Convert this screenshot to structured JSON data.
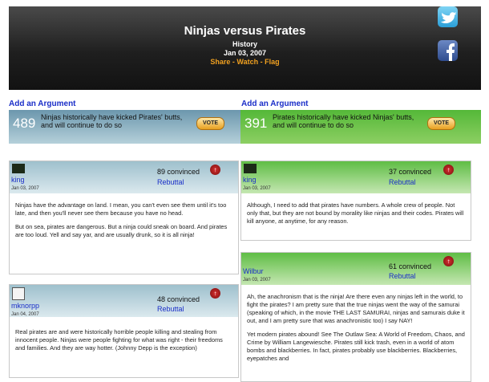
{
  "header": {
    "title": "Ninjas versus Pirates",
    "category": "History",
    "date": "Jan 03, 2007",
    "links": [
      "Share",
      "Watch",
      "Flag"
    ],
    "separator": " - "
  },
  "icons": {
    "twitter": "twitter-icon",
    "facebook": "facebook-icon",
    "rebuttal_up": "up-arrow-icon",
    "avatar": "user-avatar"
  },
  "colors": {
    "accent_link": "#1a2ec8",
    "header_link": "#f0a020",
    "blue_side": "#6c97ad",
    "green_side": "#54b838"
  },
  "left": {
    "add_label": "Add an Argument",
    "argument": {
      "count": "489",
      "text": "Ninjas historically have kicked Pirates' butts, and will continue to do so",
      "vote": "VOTE"
    },
    "rebuttals": [
      {
        "user": "king",
        "date": "Jan 03, 2007",
        "convinced": "89 convinced",
        "rebuttal": "Rebuttal",
        "paragraphs": [
          "Ninjas have the advantage on land. I mean, you can't even see them until it's too late, and then you'll never see them because you have no head.",
          "But on sea, pirates are dangerous. But a ninja could sneak on board. And pirates are too loud. Yell and say yar, and are usually drunk, so it is all ninja!"
        ]
      },
      {
        "user": "mknorpp",
        "date": "Jan 04, 2007",
        "convinced": "48 convinced",
        "rebuttal": "Rebuttal",
        "paragraphs": [
          "Real pirates are and were historically horrible people killing and stealing from innocent people. Ninjas were people fighting for what was right - their freedoms and families. And they are way hotter. (Johnny Depp is the exception)"
        ]
      }
    ]
  },
  "right": {
    "add_label": "Add an Argument",
    "argument": {
      "count": "391",
      "text": "Pirates historically have kicked Ninjas' butts, and will continue to do so",
      "vote": "VOTE"
    },
    "rebuttals": [
      {
        "user": "king",
        "date": "Jan 03, 2007",
        "convinced": "37 convinced",
        "rebuttal": "Rebuttal",
        "paragraphs": [
          "Although, I need to add that pirates have numbers. A whole crew of people. Not only that, but they are not bound by morality like ninjas and their codes. Pirates will kill anyone, at anytime, for any reason."
        ]
      },
      {
        "user": "Wilbur",
        "date": "Jan 03, 2007",
        "convinced": "61 convinced",
        "rebuttal": "Rebuttal",
        "paragraphs": [
          "Ah, the anachronism that is the ninja! Are there even any ninjas left in the world, to fight the pirates? I am pretty sure that the true ninjas went the way of the samurai (speaking of which, in the movie THE LAST SAMURAI, ninjas and samurais duke it out, and I am pretty sure that was anachronistic too) I say NAY!",
          "Yet modern pirates abound! See The Outlaw Sea: A World of Freedom, Chaos, and Crime by William Langewiesche. Pirates still kick trash, even in a world of atom bombs and blackberries. In fact, pirates probably use blackberries. Blackberries, eyepatches and"
        ]
      }
    ]
  }
}
